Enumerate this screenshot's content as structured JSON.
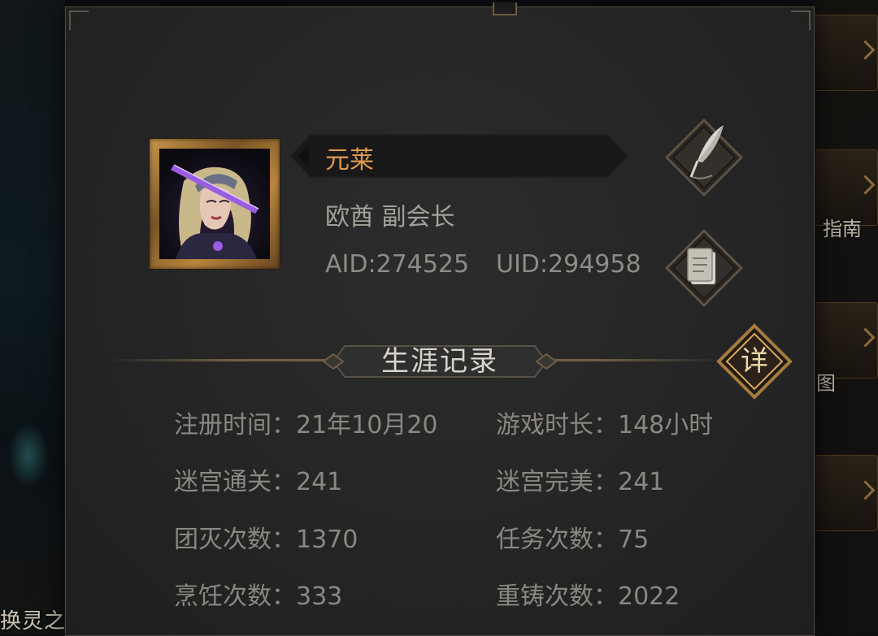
{
  "player": {
    "name": "元莱",
    "guild": "欧酋 副会长",
    "aid": "AID:274525",
    "uid": "UID:294958"
  },
  "section": {
    "title": "生涯记录",
    "detail_label": "详"
  },
  "stats": {
    "left": [
      {
        "label": "注册时间：",
        "value": "21年10月20"
      },
      {
        "label": "迷宫通关：",
        "value": "241"
      },
      {
        "label": "团灭次数：",
        "value": "1370"
      },
      {
        "label": "烹饪次数：",
        "value": "333"
      }
    ],
    "right": [
      {
        "label": "游戏时长：",
        "value": "148小时"
      },
      {
        "label": "迷宫完美：",
        "value": "241"
      },
      {
        "label": "任务次数：",
        "value": "75"
      },
      {
        "label": "重铸次数：",
        "value": "2022"
      }
    ]
  },
  "background": {
    "left_caption": "换灵之",
    "right_caption_1": "指南",
    "right_caption_2": "图"
  },
  "icons": {
    "edit": "quill-icon",
    "copy": "scroll-icon",
    "detail": "detail-icon"
  },
  "colors": {
    "name": "#e09a52",
    "gold": "#c9964a",
    "panel": "#262626",
    "text_muted": "#8a8781"
  }
}
